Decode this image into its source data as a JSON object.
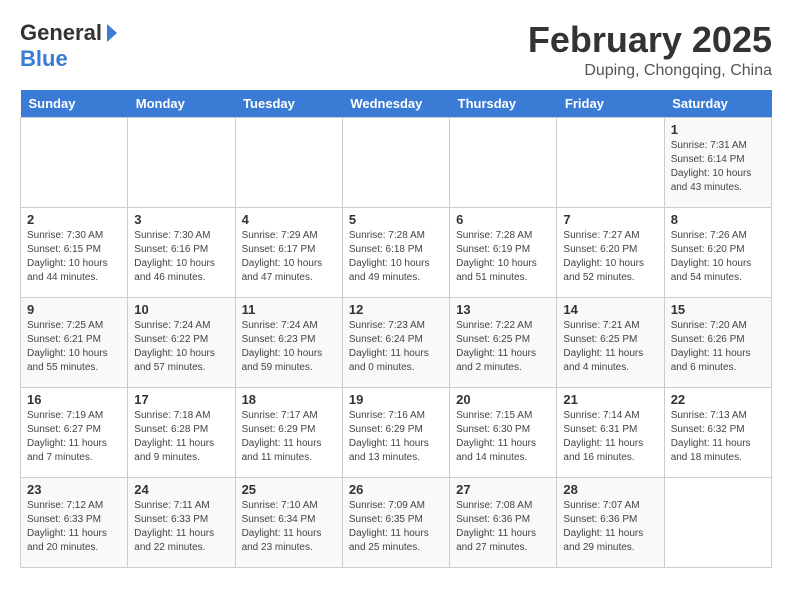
{
  "header": {
    "logo_general": "General",
    "logo_blue": "Blue",
    "title": "February 2025",
    "subtitle": "Duping, Chongqing, China"
  },
  "weekdays": [
    "Sunday",
    "Monday",
    "Tuesday",
    "Wednesday",
    "Thursday",
    "Friday",
    "Saturday"
  ],
  "weeks": [
    [
      {
        "day": "",
        "info": ""
      },
      {
        "day": "",
        "info": ""
      },
      {
        "day": "",
        "info": ""
      },
      {
        "day": "",
        "info": ""
      },
      {
        "day": "",
        "info": ""
      },
      {
        "day": "",
        "info": ""
      },
      {
        "day": "1",
        "info": "Sunrise: 7:31 AM\nSunset: 6:14 PM\nDaylight: 10 hours and 43 minutes."
      }
    ],
    [
      {
        "day": "2",
        "info": "Sunrise: 7:30 AM\nSunset: 6:15 PM\nDaylight: 10 hours and 44 minutes."
      },
      {
        "day": "3",
        "info": "Sunrise: 7:30 AM\nSunset: 6:16 PM\nDaylight: 10 hours and 46 minutes."
      },
      {
        "day": "4",
        "info": "Sunrise: 7:29 AM\nSunset: 6:17 PM\nDaylight: 10 hours and 47 minutes."
      },
      {
        "day": "5",
        "info": "Sunrise: 7:28 AM\nSunset: 6:18 PM\nDaylight: 10 hours and 49 minutes."
      },
      {
        "day": "6",
        "info": "Sunrise: 7:28 AM\nSunset: 6:19 PM\nDaylight: 10 hours and 51 minutes."
      },
      {
        "day": "7",
        "info": "Sunrise: 7:27 AM\nSunset: 6:20 PM\nDaylight: 10 hours and 52 minutes."
      },
      {
        "day": "8",
        "info": "Sunrise: 7:26 AM\nSunset: 6:20 PM\nDaylight: 10 hours and 54 minutes."
      }
    ],
    [
      {
        "day": "9",
        "info": "Sunrise: 7:25 AM\nSunset: 6:21 PM\nDaylight: 10 hours and 55 minutes."
      },
      {
        "day": "10",
        "info": "Sunrise: 7:24 AM\nSunset: 6:22 PM\nDaylight: 10 hours and 57 minutes."
      },
      {
        "day": "11",
        "info": "Sunrise: 7:24 AM\nSunset: 6:23 PM\nDaylight: 10 hours and 59 minutes."
      },
      {
        "day": "12",
        "info": "Sunrise: 7:23 AM\nSunset: 6:24 PM\nDaylight: 11 hours and 0 minutes."
      },
      {
        "day": "13",
        "info": "Sunrise: 7:22 AM\nSunset: 6:25 PM\nDaylight: 11 hours and 2 minutes."
      },
      {
        "day": "14",
        "info": "Sunrise: 7:21 AM\nSunset: 6:25 PM\nDaylight: 11 hours and 4 minutes."
      },
      {
        "day": "15",
        "info": "Sunrise: 7:20 AM\nSunset: 6:26 PM\nDaylight: 11 hours and 6 minutes."
      }
    ],
    [
      {
        "day": "16",
        "info": "Sunrise: 7:19 AM\nSunset: 6:27 PM\nDaylight: 11 hours and 7 minutes."
      },
      {
        "day": "17",
        "info": "Sunrise: 7:18 AM\nSunset: 6:28 PM\nDaylight: 11 hours and 9 minutes."
      },
      {
        "day": "18",
        "info": "Sunrise: 7:17 AM\nSunset: 6:29 PM\nDaylight: 11 hours and 11 minutes."
      },
      {
        "day": "19",
        "info": "Sunrise: 7:16 AM\nSunset: 6:29 PM\nDaylight: 11 hours and 13 minutes."
      },
      {
        "day": "20",
        "info": "Sunrise: 7:15 AM\nSunset: 6:30 PM\nDaylight: 11 hours and 14 minutes."
      },
      {
        "day": "21",
        "info": "Sunrise: 7:14 AM\nSunset: 6:31 PM\nDaylight: 11 hours and 16 minutes."
      },
      {
        "day": "22",
        "info": "Sunrise: 7:13 AM\nSunset: 6:32 PM\nDaylight: 11 hours and 18 minutes."
      }
    ],
    [
      {
        "day": "23",
        "info": "Sunrise: 7:12 AM\nSunset: 6:33 PM\nDaylight: 11 hours and 20 minutes."
      },
      {
        "day": "24",
        "info": "Sunrise: 7:11 AM\nSunset: 6:33 PM\nDaylight: 11 hours and 22 minutes."
      },
      {
        "day": "25",
        "info": "Sunrise: 7:10 AM\nSunset: 6:34 PM\nDaylight: 11 hours and 23 minutes."
      },
      {
        "day": "26",
        "info": "Sunrise: 7:09 AM\nSunset: 6:35 PM\nDaylight: 11 hours and 25 minutes."
      },
      {
        "day": "27",
        "info": "Sunrise: 7:08 AM\nSunset: 6:36 PM\nDaylight: 11 hours and 27 minutes."
      },
      {
        "day": "28",
        "info": "Sunrise: 7:07 AM\nSunset: 6:36 PM\nDaylight: 11 hours and 29 minutes."
      },
      {
        "day": "",
        "info": ""
      }
    ]
  ]
}
